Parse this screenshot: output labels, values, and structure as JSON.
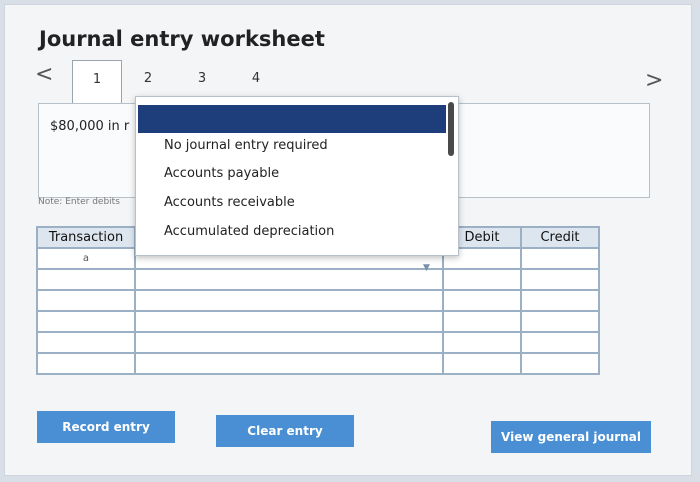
{
  "title": "Journal entry worksheet",
  "nav": {
    "prev": "<",
    "next": ">"
  },
  "tabs": [
    "1",
    "2",
    "3",
    "4"
  ],
  "instruction": "$80,000 in r",
  "note": "Note: Enter debits",
  "table": {
    "headers": {
      "transaction": "Transaction",
      "debit": "Debit",
      "credit": "Credit"
    },
    "rows": [
      "a",
      "",
      "",
      "",
      "",
      ""
    ]
  },
  "dropdown": {
    "items": [
      "No journal entry required",
      "Accounts payable",
      "Accounts receivable",
      "Accumulated depreciation"
    ]
  },
  "buttons": {
    "record": "Record entry",
    "clear": "Clear entry",
    "view": "View general journal"
  },
  "colors": {
    "accent": "#4a8fd4",
    "selected": "#1e3e7b"
  }
}
